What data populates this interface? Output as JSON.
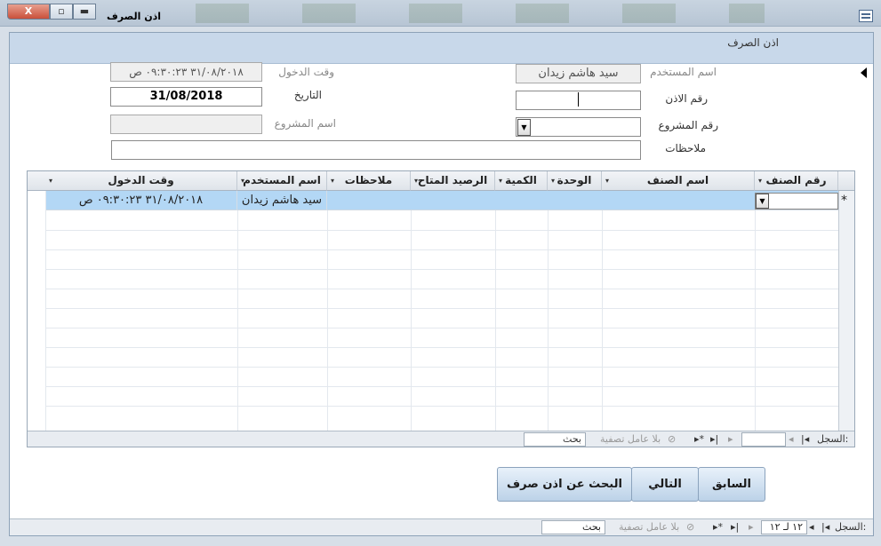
{
  "window": {
    "title": "اذن الصرف",
    "buttons": {
      "close": "X",
      "restore": "▫",
      "minimize": "▬"
    }
  },
  "form": {
    "header_title": "اذن الصرف",
    "fields": {
      "user_name": {
        "label": "اسم المستخدم",
        "value": "سيد هاشم زيدان"
      },
      "entry_time": {
        "label": "وقت الدخول",
        "value": "٣١/٠٨/٢٠١٨ ٠٩:٣٠:٢٣ ص"
      },
      "permit_no": {
        "label": "رقم الاذن",
        "value": ""
      },
      "date": {
        "label": "التاريخ",
        "value": "31/08/2018"
      },
      "project_no": {
        "label": "رقم المشروع",
        "value": ""
      },
      "project_name": {
        "label": "اسم المشروع",
        "value": ""
      },
      "notes": {
        "label": "ملاحظات",
        "value": ""
      }
    }
  },
  "grid": {
    "columns": [
      "رقم الصنف",
      "اسم الصنف",
      "الوحدة",
      "الكمية",
      "الرصيد المتاح",
      "ملاحظات",
      "اسم المستخدم",
      "وقت الدخول"
    ],
    "new_row": {
      "marker": "*",
      "user": "سيد هاشم زيدان",
      "entry_time": "٣١/٠٨/٢٠١٨ ٠٩:٣٠:٢٣ ص"
    },
    "nav": {
      "record_label": "السجل:",
      "first": "|◂",
      "prev": "◂",
      "next": "▸",
      "last": "▸|",
      "new": "▸*",
      "filter_label": "بلا عامل تصفية",
      "search_label": "بحث"
    }
  },
  "buttons": {
    "previous": "السابق",
    "next": "التالي",
    "search_permit": "البحث عن اذن صرف"
  },
  "bottom_nav": {
    "record_label": "السجل:",
    "counter": "١٢ لـ ١٢",
    "filter_label": "بلا عامل تصفية",
    "search_label": "بحث"
  }
}
